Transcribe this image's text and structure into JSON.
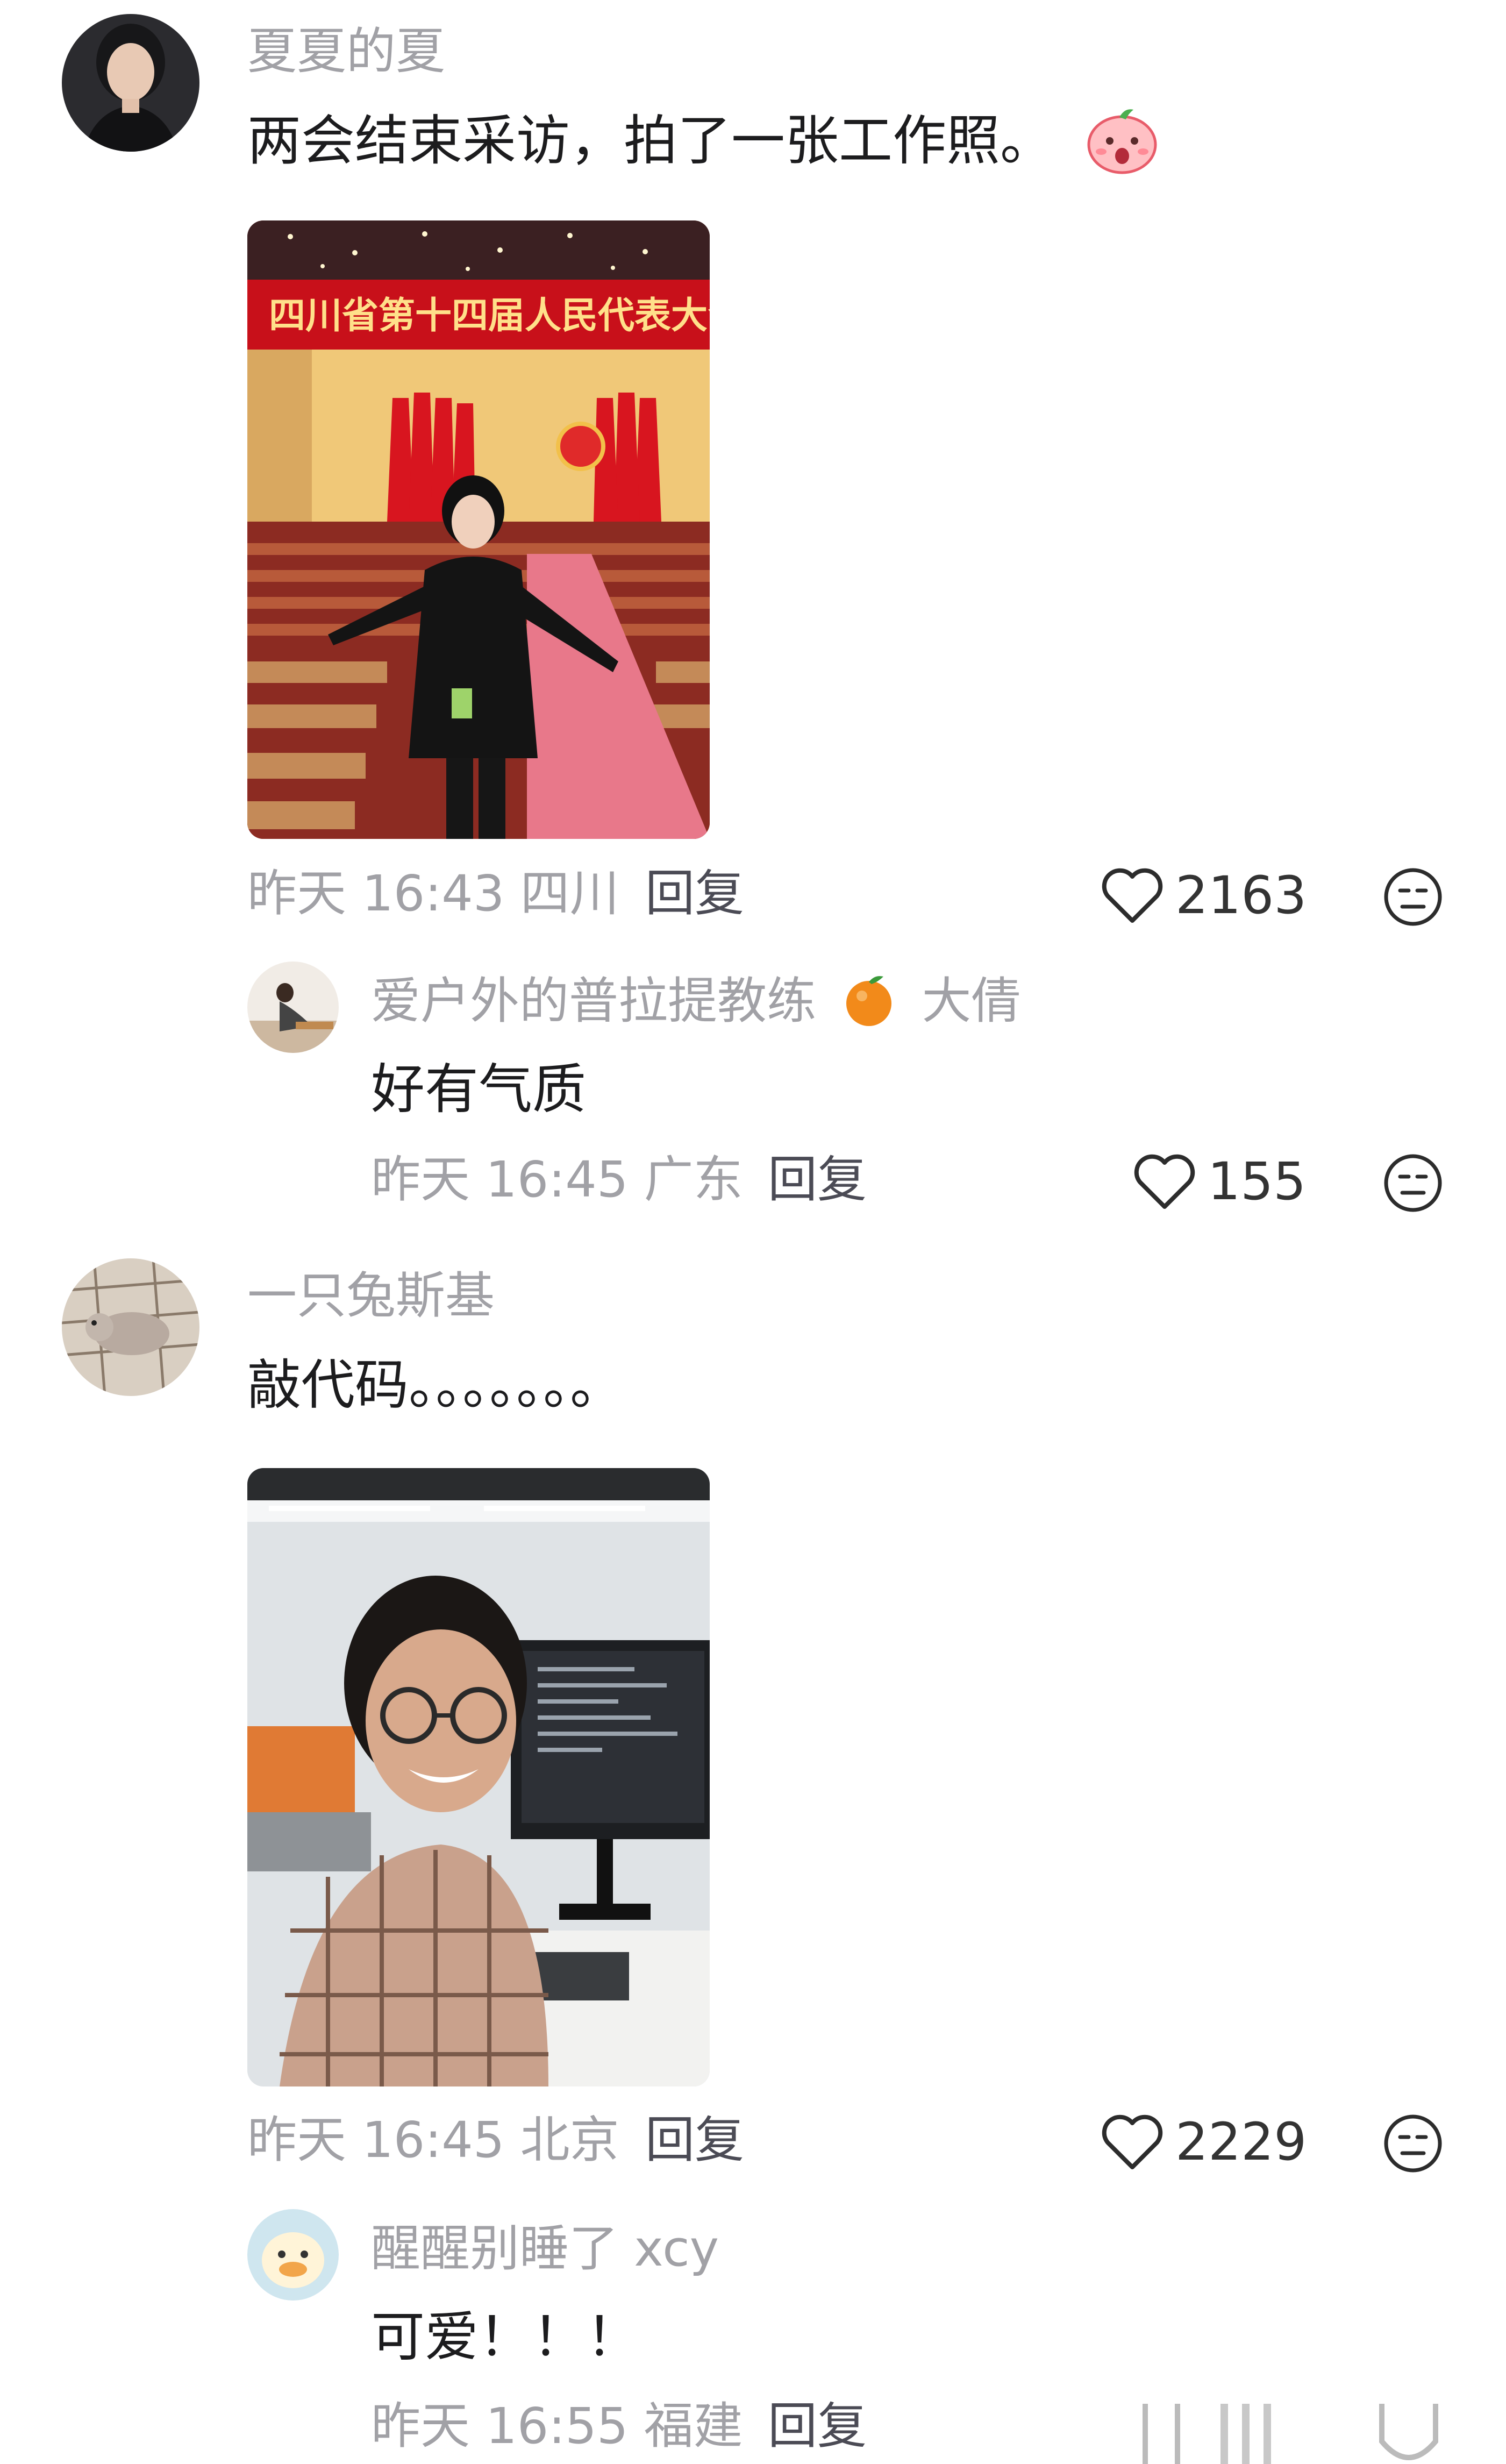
{
  "comments": [
    {
      "author": "夏夏的夏",
      "text": "两会结束采访，拍了一张工作照。",
      "image_banner": "四川省第十四届人民代表大会第五",
      "time": "昨天 16:43",
      "location": "四川",
      "reply_label": "回复",
      "likes": "2163",
      "replies": [
        {
          "author": "爱户外的普拉提教练",
          "author_suffix": "大倩",
          "text": "好有气质",
          "time": "昨天 16:45",
          "location": "广东",
          "reply_label": "回复",
          "likes": "155"
        }
      ]
    },
    {
      "author": "一只兔斯基",
      "text": "敲代码。。。。。。。",
      "time": "昨天 16:45",
      "location": "北京",
      "reply_label": "回复",
      "likes": "2229",
      "replies": [
        {
          "author": "醒醒别睡了 xcy",
          "text": "可爱！！！",
          "time": "昨天 16:55",
          "location": "福建",
          "reply_label": "回复"
        }
      ]
    }
  ],
  "icons": {
    "like": "heart-outline-icon",
    "dislike": "neutral-face-icon",
    "emoji_shocked": "shocked-peach-emoji",
    "emoji_orange": "orange-emoji"
  },
  "colors": {
    "name_gray": "#a1a1a6",
    "text_dark": "#1c1c1e",
    "reply_gray": "#4b4b55",
    "banner_red": "#c8101a",
    "banner_text": "#ffe08a"
  }
}
